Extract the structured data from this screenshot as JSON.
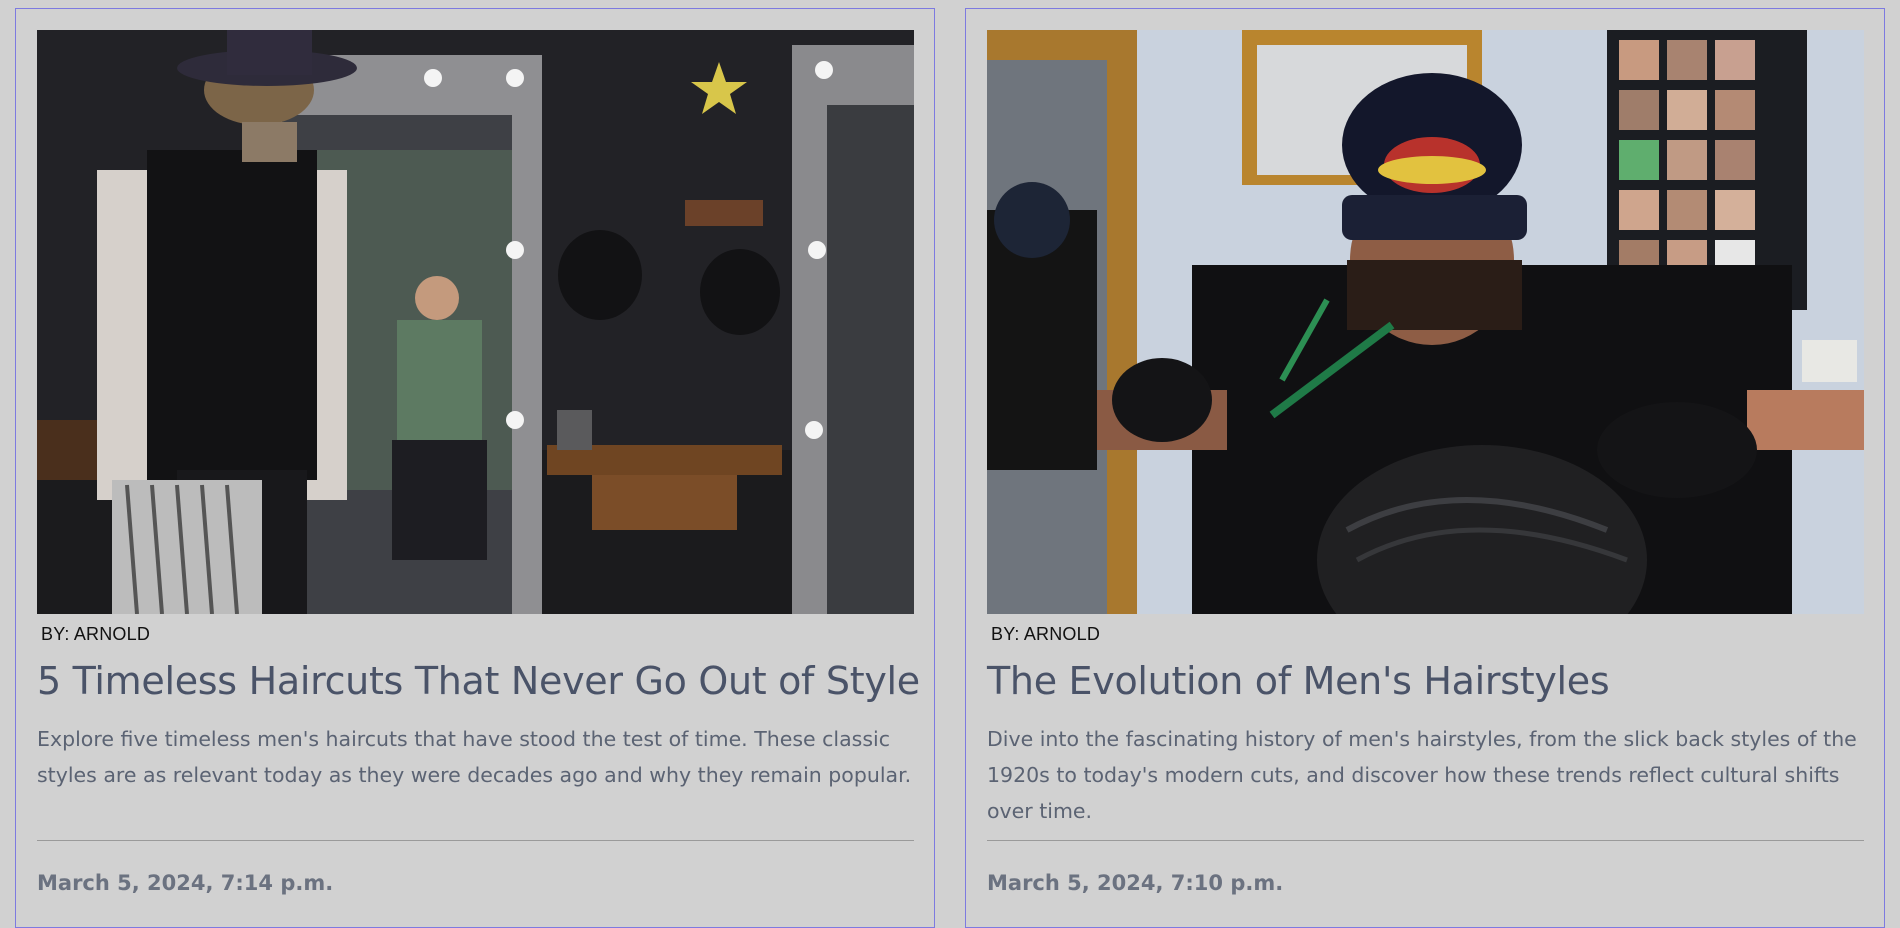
{
  "posts": [
    {
      "image_alt": "Barber in hat and vest standing before a barbershop mirror with a seated customer",
      "byline": "BY: ARNOLD",
      "title": "5 Timeless Haircuts That Never Go Out of Style",
      "excerpt": "Explore five timeless men's haircuts that have stood the test of time. These classic styles are as relevant today as they were decades ago and why they remain popular.",
      "date": "March 5, 2024, 7:14 p.m."
    },
    {
      "image_alt": "Barber in Cavaliers cap and black gloves cutting a client's hair with scissors",
      "byline": "BY: ARNOLD",
      "title": "The Evolution of Men's Hairstyles",
      "excerpt": "Dive into the fascinating history of men's hairstyles, from the slick back styles of the 1920s to today's modern cuts, and discover how these trends reflect cultural shifts over time.",
      "date": "March 5, 2024, 7:10 p.m."
    }
  ],
  "colors": {
    "page_bg": "#d1d1d1",
    "card_border": "#7d7ae0",
    "title": "#4a5368",
    "excerpt": "#5b6373",
    "date": "#6b7280"
  }
}
